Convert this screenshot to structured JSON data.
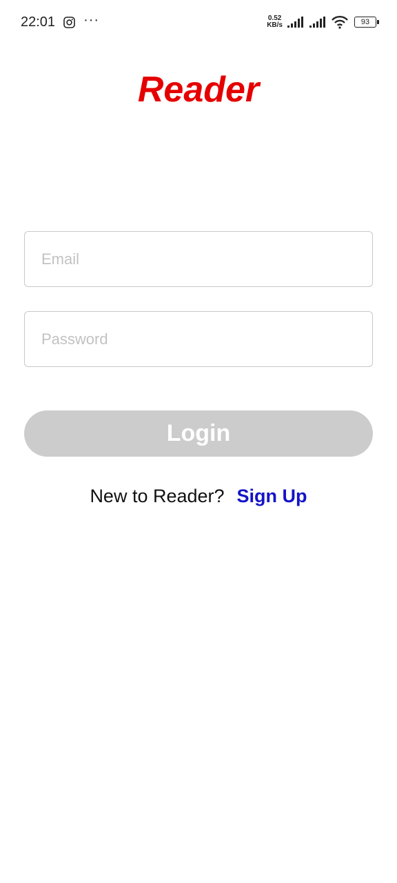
{
  "status_bar": {
    "time": "22:01",
    "more": "···",
    "net_speed_value": "0.52",
    "net_speed_unit": "KB/s",
    "battery_level": "93",
    "icons": [
      "instagram-icon",
      "more-icon",
      "signal-icon",
      "signal-icon",
      "wifi-icon",
      "battery-icon"
    ]
  },
  "app": {
    "title": "Reader",
    "title_color": "#e50000"
  },
  "form": {
    "email_placeholder": "Email",
    "email_value": "",
    "password_placeholder": "Password",
    "password_value": "",
    "login_label": "Login",
    "login_color": "#cccccc"
  },
  "signup": {
    "prompt": "New to Reader?",
    "link_label": "Sign Up",
    "link_color": "#1414c8"
  }
}
